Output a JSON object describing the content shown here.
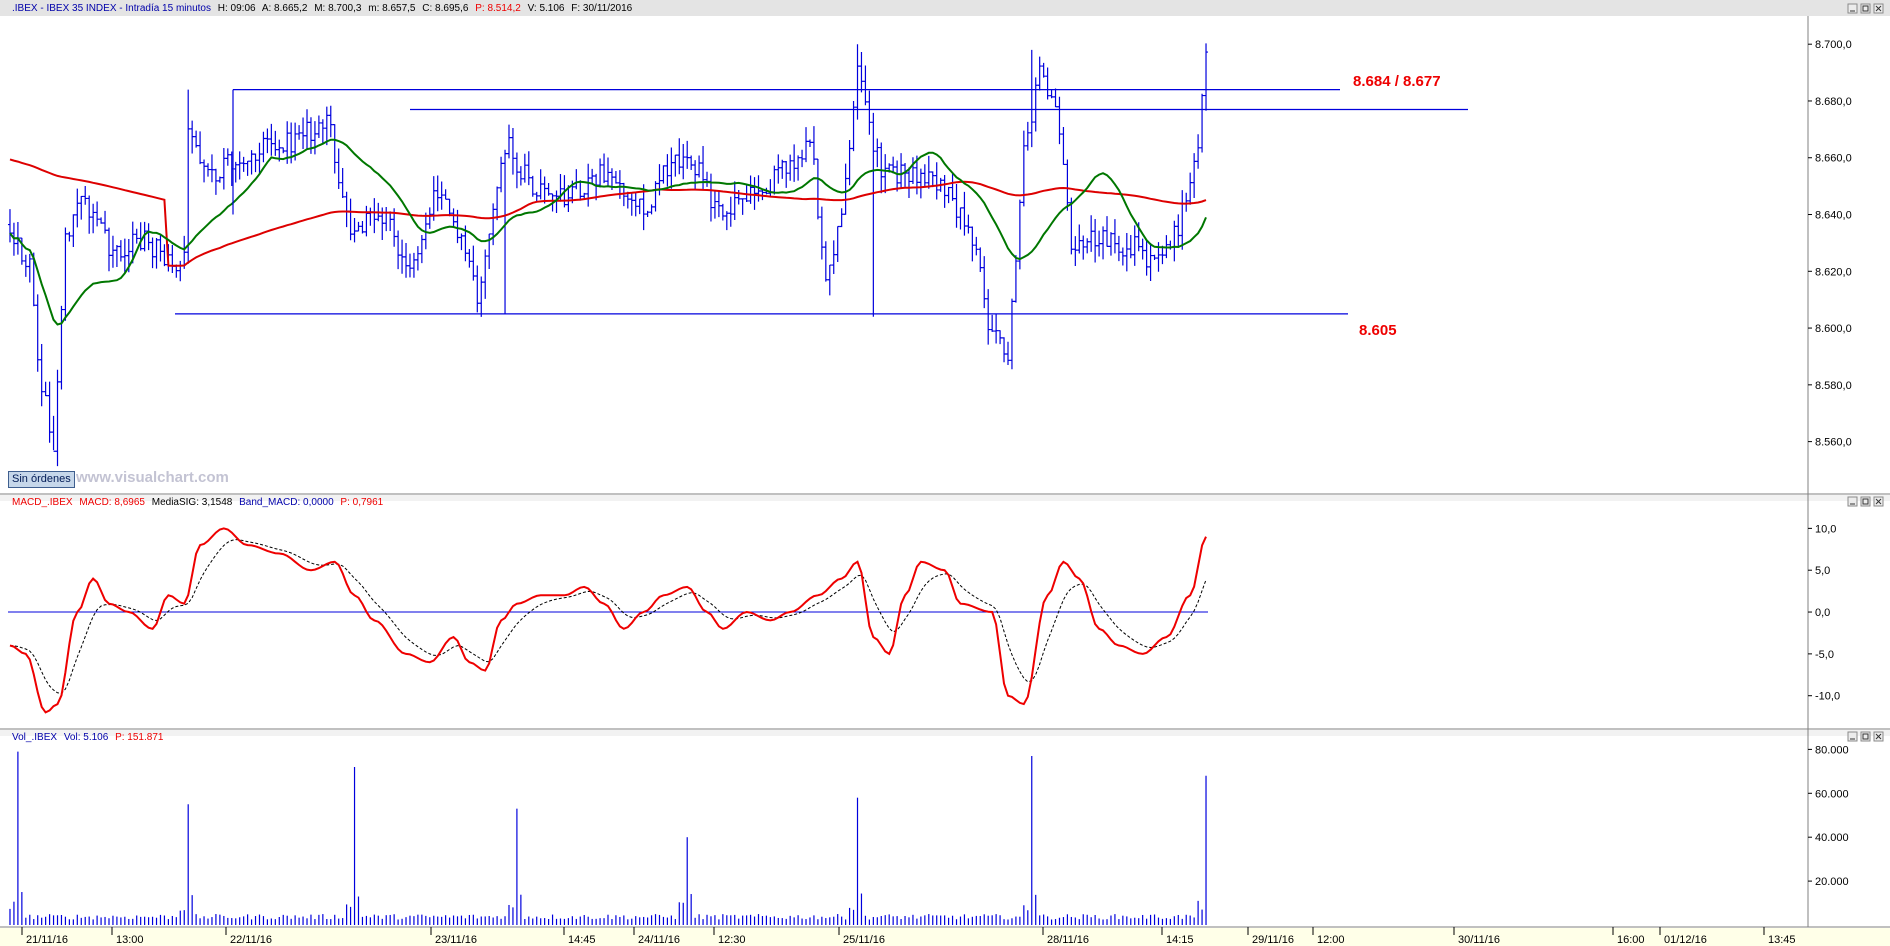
{
  "panels": {
    "price": {
      "header": {
        "name": ".IBEX - IBEX 35 INDEX - Intradía 15 minutos",
        "h": "H: 09:06",
        "a": "A: 8.665,2",
        "m": "M: 8.700,3",
        "min": "m: 8.657,5",
        "c": "C: 8.695,6",
        "p": "P: 8.514,2",
        "v": "V: 5.106",
        "f": "F: 30/11/2016"
      },
      "button_label": "Sin órdenes",
      "watermark": "www.visualchart.com",
      "annotations": {
        "resistance": "8.684 / 8.677",
        "support": "8.605"
      },
      "axis_ticks": [
        "8.700,0",
        "8.680,0",
        "8.660,0",
        "8.640,0",
        "8.620,0",
        "8.600,0",
        "8.580,0",
        "8.560,0"
      ]
    },
    "macd": {
      "header": {
        "name": "MACD_.IBEX",
        "macd": "MACD: 8,6965",
        "sig": "MediaSIG: 3,1548",
        "band": "Band_MACD: 0,0000",
        "p": "P: 0,7961"
      },
      "axis_ticks": [
        "10,0",
        "5,0",
        "0,0",
        "-5,0",
        "-10,0"
      ]
    },
    "volume": {
      "header": {
        "name": "Vol_.IBEX",
        "vol": "Vol: 5.106",
        "p": "P: 151.871"
      },
      "axis_ticks": [
        "80.000",
        "60.000",
        "40.000",
        "20.000"
      ]
    }
  },
  "time_axis": {
    "labels": [
      "21/11/16",
      "13:00",
      "22/11/16",
      "23/11/16",
      "14:45",
      "24/11/16",
      "12:30",
      "25/11/16",
      "28/11/16",
      "14:15",
      "29/11/16",
      "12:00",
      "30/11/16",
      "16:00",
      "01/12/16",
      "13:45"
    ]
  },
  "colors": {
    "bars": "#0000dd",
    "sma_long": "#dd0000",
    "sma_short": "#007700",
    "macd": "#ee0000",
    "signal": "#000000",
    "annotation": "#ee0000",
    "lines": "#0000dd"
  },
  "chart_data": [
    {
      "type": "ohlc",
      "panel": "price",
      "ylim": [
        8550,
        8705
      ],
      "bars": [],
      "levels": [
        {
          "label": "8.684 / 8.677",
          "values": [
            8684,
            8677
          ]
        },
        {
          "label": "8.605",
          "values": [
            8605
          ]
        }
      ],
      "series": [
        {
          "type": "line"
        },
        {
          "type": "line"
        }
      ]
    },
    {
      "type": "line",
      "panel": "macd",
      "ylim": [
        -13.5,
        11
      ],
      "series": [
        {
          "name": "MACD",
          "values": []
        },
        {
          "name": "MediaSIG",
          "values": []
        }
      ],
      "band": 0
    },
    {
      "type": "bar",
      "panel": "volume",
      "ylim": [
        0,
        82000
      ],
      "values": []
    }
  ]
}
